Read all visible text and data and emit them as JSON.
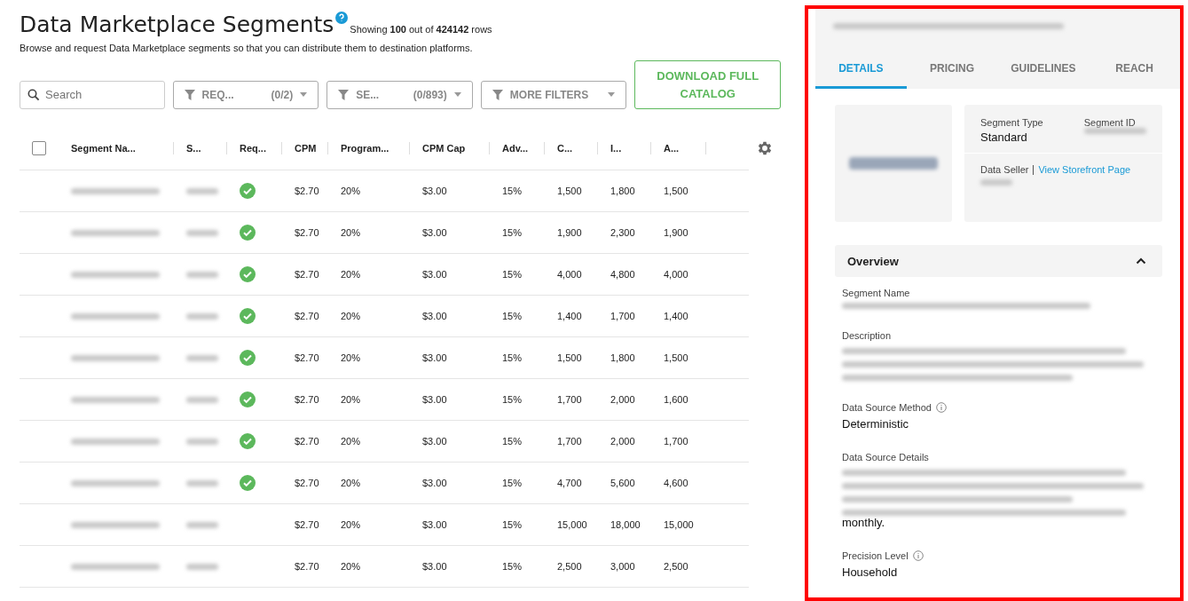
{
  "header": {
    "title": "Data Marketplace Segments",
    "showing": "Showing **100** out of **424142** rows",
    "subtitle": "Browse and request Data Marketplace segments so that you can distribute them to destination platforms."
  },
  "toolbar": {
    "search": {
      "placeholder": "Search"
    },
    "filters": [
      {
        "label": "REQ...",
        "count": "(0/2)"
      },
      {
        "label": "SE...",
        "count": "(0/893)"
      },
      {
        "label": "MORE FILTERS"
      }
    ],
    "download_button": "DOWNLOAD FULL CATALOG"
  },
  "table": {
    "select_all": {
      "checked": false
    },
    "columns": [
      "Segment Na...",
      "S...",
      "Req...",
      "CPM",
      "Program...",
      "CPM Cap",
      "Adv...",
      "C...",
      "I...",
      "A..."
    ],
    "rows": [
      {
        "requested": true,
        "cpm": "$2.70",
        "program": "20%",
        "cpm_cap": "$3.00",
        "adv": "15%",
        "c": "1,500",
        "i": "1,800",
        "a": "1,500"
      },
      {
        "requested": true,
        "cpm": "$2.70",
        "program": "20%",
        "cpm_cap": "$3.00",
        "adv": "15%",
        "c": "1,900",
        "i": "2,300",
        "a": "1,900"
      },
      {
        "requested": true,
        "cpm": "$2.70",
        "program": "20%",
        "cpm_cap": "$3.00",
        "adv": "15%",
        "c": "4,000",
        "i": "4,800",
        "a": "4,000"
      },
      {
        "requested": true,
        "cpm": "$2.70",
        "program": "20%",
        "cpm_cap": "$3.00",
        "adv": "15%",
        "c": "1,400",
        "i": "1,700",
        "a": "1,400"
      },
      {
        "requested": true,
        "cpm": "$2.70",
        "program": "20%",
        "cpm_cap": "$3.00",
        "adv": "15%",
        "c": "1,500",
        "i": "1,800",
        "a": "1,500"
      },
      {
        "requested": true,
        "cpm": "$2.70",
        "program": "20%",
        "cpm_cap": "$3.00",
        "adv": "15%",
        "c": "1,700",
        "i": "2,000",
        "a": "1,600"
      },
      {
        "requested": true,
        "cpm": "$2.70",
        "program": "20%",
        "cpm_cap": "$3.00",
        "adv": "15%",
        "c": "1,700",
        "i": "2,000",
        "a": "1,700"
      },
      {
        "requested": true,
        "cpm": "$2.70",
        "program": "20%",
        "cpm_cap": "$3.00",
        "adv": "15%",
        "c": "4,700",
        "i": "5,600",
        "a": "4,600"
      },
      {
        "requested": false,
        "cpm": "$2.70",
        "program": "20%",
        "cpm_cap": "$3.00",
        "adv": "15%",
        "c": "15,000",
        "i": "18,000",
        "a": "15,000"
      },
      {
        "requested": false,
        "cpm": "$2.70",
        "program": "20%",
        "cpm_cap": "$3.00",
        "adv": "15%",
        "c": "2,500",
        "i": "3,000",
        "a": "2,500"
      }
    ]
  },
  "detail_panel": {
    "tabs": [
      {
        "label": "DETAILS",
        "selected": true
      },
      {
        "label": "PRICING",
        "selected": false
      },
      {
        "label": "GUIDELINES",
        "selected": false
      },
      {
        "label": "REACH",
        "selected": false
      }
    ],
    "segment_type_label": "Segment Type",
    "segment_type": "Standard",
    "segment_id_label": "Segment ID",
    "data_seller_label": "Data Seller",
    "storefront_link": "View Storefront Page",
    "overview": {
      "title": "Overview",
      "expanded": true,
      "fields": [
        {
          "label": "Segment Name",
          "info": false,
          "kind": "redacted-short"
        },
        {
          "label": "Description",
          "info": false,
          "kind": "redacted-long"
        },
        {
          "label": "Data Source Method",
          "info": true,
          "kind": "text",
          "value": "Deterministic"
        },
        {
          "label": "Data Source Details",
          "info": false,
          "kind": "redacted-long",
          "value": "monthly."
        },
        {
          "label": "Precision Level",
          "info": true,
          "kind": "text",
          "value": "Household"
        }
      ]
    }
  }
}
